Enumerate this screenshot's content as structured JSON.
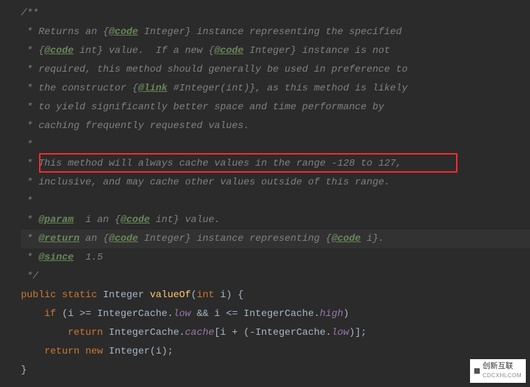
{
  "code": {
    "l1": "/**",
    "l2_a": " * Returns an {",
    "l2_tag": "@code",
    "l2_b": " Integer} instance representing the specified",
    "l3_a": " * {",
    "l3_tag": "@code",
    "l3_b": " int} value.  If a new {",
    "l3_tag2": "@code",
    "l3_c": " Integer} instance is not",
    "l4": " * required, this method should generally be used in preference to",
    "l5_a": " * the constructor {",
    "l5_tag": "@link",
    "l5_b": " #Integer(int)}, as this method is likely",
    "l6": " * to yield significantly better space and time performance by",
    "l7": " * caching frequently requested values.",
    "l8": " *",
    "l9": " * This method will always cache values in the range -128 to 127,",
    "l10": " * inclusive, and may cache other values outside of this range.",
    "l11": " *",
    "l12_a": " * ",
    "l12_tag": "@param",
    "l12_b": "  i an {",
    "l12_tag2": "@code",
    "l12_c": " int} value.",
    "l13_a": " * ",
    "l13_tag": "@return",
    "l13_b": " an {",
    "l13_tag2": "@code",
    "l13_c": " Integer} instance representing {",
    "l13_tag3": "@code",
    "l13_d": " i}.",
    "l14_a": " * ",
    "l14_tag": "@since",
    "l14_b": "  1.5",
    "l15": " */",
    "l16_kw1": "public",
    "l16_kw2": "static",
    "l16_type": "Integer",
    "l16_method": "valueOf",
    "l16_kw3": "int",
    "l16_param": " i)",
    "l16_brace": " {",
    "l17_kw": "if",
    "l17_a": " (i >= IntegerCache.",
    "l17_low": "low",
    "l17_b": " && i <= IntegerCache.",
    "l17_high": "high",
    "l17_c": ")",
    "l18_kw": "return",
    "l18_a": " IntegerCache.",
    "l18_cache": "cache",
    "l18_b": "[i + (-IntegerCache.",
    "l18_low": "low",
    "l18_c": ")];",
    "l19_kw1": "return",
    "l19_kw2": "new",
    "l19_a": " Integer(i);",
    "l20": "}"
  },
  "watermark": {
    "title": "创新互联",
    "sub": "CDCXHLCOM"
  }
}
